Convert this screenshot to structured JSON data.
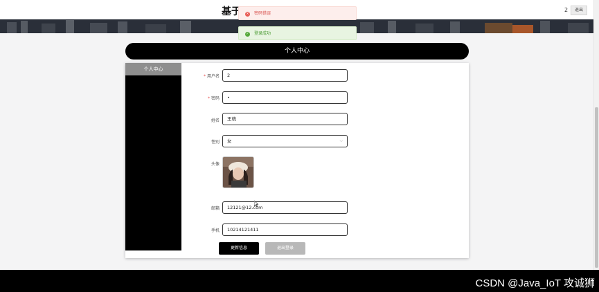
{
  "header": {
    "site_title": "基于",
    "user_id": "2",
    "logout_label": "退出"
  },
  "toasts": {
    "error": {
      "text": "密码错误",
      "icon": "close-circle-icon",
      "color": "#d9534f"
    },
    "success": {
      "text": "登录成功",
      "icon": "check-circle-icon",
      "color": "#4a9a32"
    }
  },
  "page": {
    "title": "个人中心"
  },
  "sidebar": {
    "items": [
      {
        "label": "个人中心"
      }
    ]
  },
  "form": {
    "username": {
      "label": "用户名",
      "required": "*",
      "value": "2"
    },
    "password": {
      "label": "密码",
      "required": "*",
      "value": "•"
    },
    "name": {
      "label": "姓名",
      "value": "王萌"
    },
    "gender": {
      "label": "性别",
      "value": "女",
      "icon": "chevron-down-icon"
    },
    "avatar": {
      "label": "头像"
    },
    "email": {
      "label": "邮箱",
      "value": "12121@12.com"
    },
    "phone": {
      "label": "手机",
      "value": "10214121411"
    }
  },
  "actions": {
    "update_label": "更新信息",
    "logout_label": "退出登录"
  },
  "watermark": {
    "text": "CSDN @Java_IoT 攻诚狮"
  },
  "colors": {
    "accent": "#000000",
    "sidebar_active": "#8e8e8e",
    "disabled_button": "#b8b8b8"
  }
}
